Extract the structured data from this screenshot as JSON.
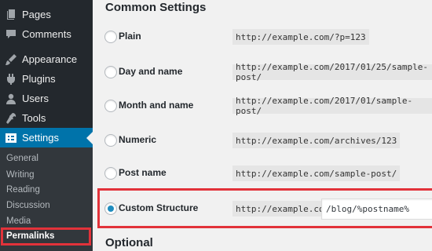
{
  "sidebar": {
    "items": [
      {
        "label": "Pages",
        "icon": "pages-icon"
      },
      {
        "label": "Comments",
        "icon": "comments-icon"
      },
      {
        "label": "Appearance",
        "icon": "appearance-icon"
      },
      {
        "label": "Plugins",
        "icon": "plugins-icon"
      },
      {
        "label": "Users",
        "icon": "users-icon"
      },
      {
        "label": "Tools",
        "icon": "tools-icon"
      },
      {
        "label": "Settings",
        "icon": "settings-icon",
        "current": true
      }
    ],
    "submenu": [
      {
        "label": "General"
      },
      {
        "label": "Writing"
      },
      {
        "label": "Reading"
      },
      {
        "label": "Discussion"
      },
      {
        "label": "Media"
      },
      {
        "label": "Permalinks",
        "active": true
      }
    ]
  },
  "main": {
    "section_title": "Common Settings",
    "options": [
      {
        "label": "Plain",
        "example": "http://example.com/?p=123",
        "checked": false
      },
      {
        "label": "Day and name",
        "example": "http://example.com/2017/01/25/sample-post/",
        "checked": false
      },
      {
        "label": "Month and name",
        "example": "http://example.com/2017/01/sample-post/",
        "checked": false
      },
      {
        "label": "Numeric",
        "example": "http://example.com/archives/123",
        "checked": false
      },
      {
        "label": "Post name",
        "example": "http://example.com/sample-post/",
        "checked": false
      },
      {
        "label": "Custom Structure",
        "example": "http://example.com",
        "value": "/blog/%postname%",
        "checked": true
      }
    ],
    "optional_title": "Optional"
  },
  "colors": {
    "sidebar_bg": "#23282d",
    "submenu_bg": "#32373c",
    "current_bg": "#0073aa",
    "highlight": "#e2323a",
    "radio_dot": "#1e8cbe"
  }
}
